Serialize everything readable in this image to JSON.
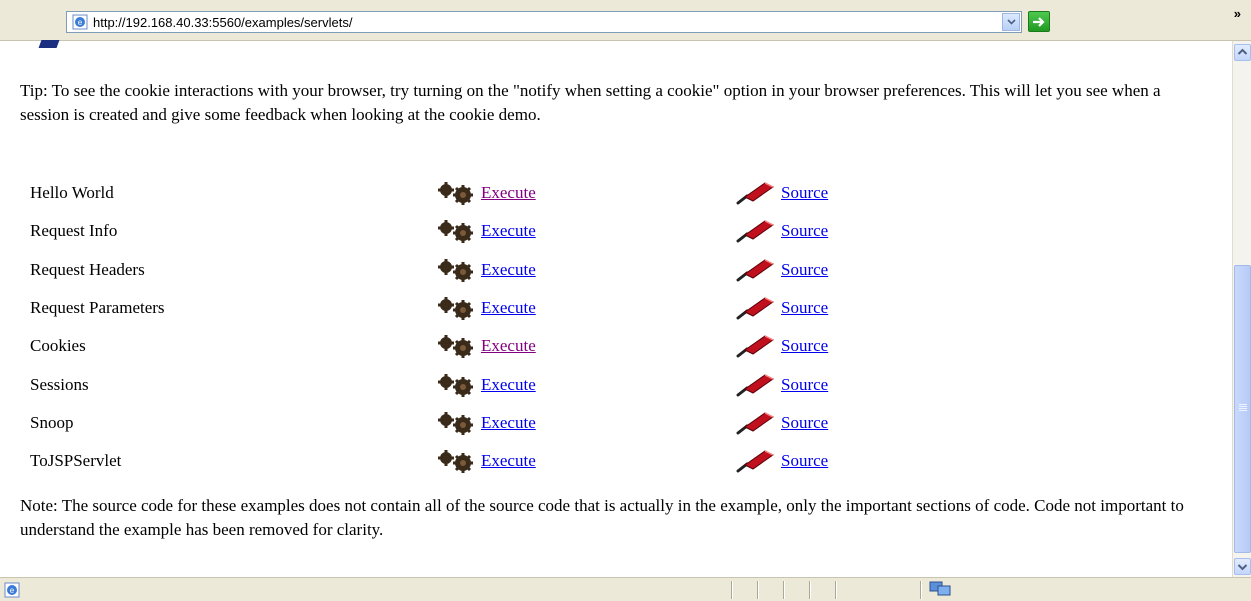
{
  "address_bar": {
    "url": "http://192.168.40.33:5560/examples/servlets/"
  },
  "content": {
    "tip": "Tip: To see the cookie interactions with your browser, try turning on the \"notify when setting a cookie\" option in your browser preferences. This will let you see when a session is created and give some feedback when looking at the cookie demo.",
    "examples": [
      {
        "label": "Hello World",
        "execute": "Execute",
        "execute_visited": true,
        "source": "Source"
      },
      {
        "label": "Request Info",
        "execute": "Execute",
        "execute_visited": false,
        "source": "Source"
      },
      {
        "label": "Request Headers",
        "execute": "Execute",
        "execute_visited": false,
        "source": "Source"
      },
      {
        "label": "Request Parameters",
        "execute": "Execute",
        "execute_visited": false,
        "source": "Source"
      },
      {
        "label": "Cookies",
        "execute": "Execute",
        "execute_visited": true,
        "source": "Source"
      },
      {
        "label": "Sessions",
        "execute": "Execute",
        "execute_visited": false,
        "source": "Source"
      },
      {
        "label": "Snoop",
        "execute": "Execute",
        "execute_visited": false,
        "source": "Source"
      },
      {
        "label": "ToJSPServlet",
        "execute": "Execute",
        "execute_visited": false,
        "source": "Source"
      }
    ],
    "note": "Note: The source code for these examples does not contain all of the source code that is actually in the example, only the important sections of code. Code not important to understand the example has been removed for clarity."
  },
  "icons": {
    "address": "ie-page-icon",
    "dropdown": "chevron-down-icon",
    "go": "go-arrow-icon",
    "more": "double-chevron-icon",
    "execute": "gears-icon",
    "source": "pen-icon",
    "status": "ie-page-icon",
    "network": "network-icon"
  },
  "colors": {
    "link": "#0000ee",
    "visited_link": "#800080",
    "chrome": "#ece9d8",
    "scrollbar_thumb": "#c1d3fb"
  },
  "scroll": {
    "thumb_start_fraction": 0.42,
    "thumb_size_fraction": 0.54
  }
}
